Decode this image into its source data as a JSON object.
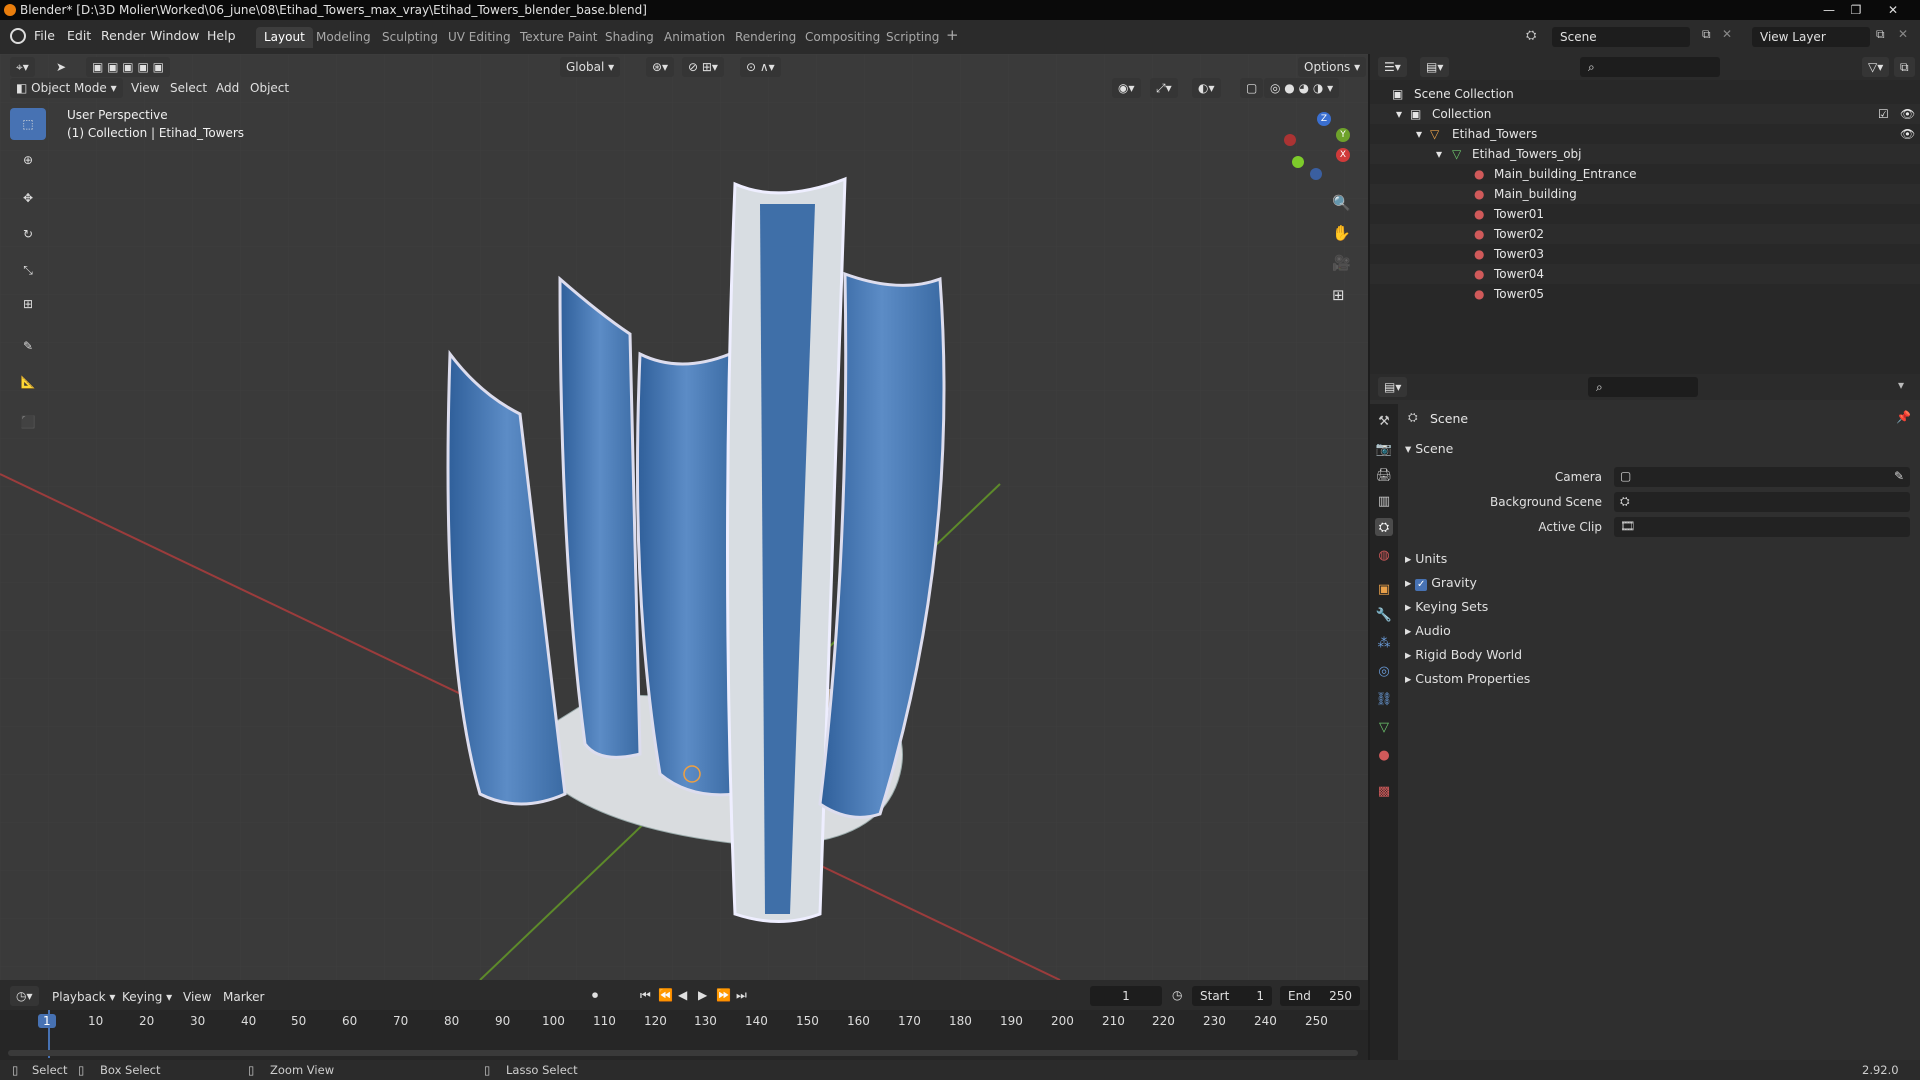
{
  "window": {
    "title": "Blender* [D:\\3D Molier\\Worked\\06_june\\08\\Etihad_Towers_max_vray\\Etihad_Towers_blender_base.blend]"
  },
  "menu": {
    "items": [
      "File",
      "Edit",
      "Render",
      "Window",
      "Help"
    ]
  },
  "workspaces": {
    "tabs": [
      "Layout",
      "Modeling",
      "Sculpting",
      "UV Editing",
      "Texture Paint",
      "Shading",
      "Animation",
      "Rendering",
      "Compositing",
      "Scripting"
    ],
    "active": "Layout",
    "add": "+"
  },
  "topright": {
    "scene": "Scene",
    "view_layer": "View Layer"
  },
  "viewport": {
    "transform_orientation": "Global",
    "options": "Options",
    "mode": "Object Mode",
    "menus": [
      "View",
      "Select",
      "Add",
      "Object"
    ],
    "overlay_line1": "User Perspective",
    "overlay_line2": "(1) Collection | Etihad_Towers",
    "gizmo": {
      "x": "X",
      "y": "Y",
      "z": "Z"
    }
  },
  "outliner": {
    "root": "Scene Collection",
    "collection": "Collection",
    "object": "Etihad_Towers",
    "mesh": "Etihad_Towers_obj",
    "materials": [
      "Main_building_Entrance",
      "Main_building",
      "Tower01",
      "Tower02",
      "Tower03",
      "Tower04",
      "Tower05"
    ]
  },
  "properties": {
    "header": "Scene",
    "panel": "Scene",
    "camera_label": "Camera",
    "bg_scene_label": "Background Scene",
    "active_clip_label": "Active Clip",
    "subpanels": [
      "Units",
      "Gravity",
      "Keying Sets",
      "Audio",
      "Rigid Body World",
      "Custom Properties"
    ],
    "gravity_checked": true
  },
  "timeline": {
    "menus": [
      "Playback",
      "Keying",
      "View",
      "Marker"
    ],
    "current_frame": "1",
    "start_label": "Start",
    "start": "1",
    "end_label": "End",
    "end": "250",
    "ticks": [
      "1",
      "10",
      "20",
      "30",
      "40",
      "50",
      "60",
      "70",
      "80",
      "90",
      "100",
      "110",
      "120",
      "130",
      "140",
      "150",
      "160",
      "170",
      "180",
      "190",
      "200",
      "210",
      "220",
      "230",
      "240",
      "250"
    ]
  },
  "status": {
    "select": "Select",
    "box_select": "Box Select",
    "zoom_view": "Zoom View",
    "lasso_select": "Lasso Select",
    "version": "2.92.0"
  },
  "colors": {
    "accent": "#4772b3",
    "viewport_bg": "#3d3d3d",
    "axis_x": "#d03a3a",
    "axis_y": "#6ea22b",
    "axis_z": "#3a6fd0",
    "tower_blue": "#3f6fa8"
  }
}
